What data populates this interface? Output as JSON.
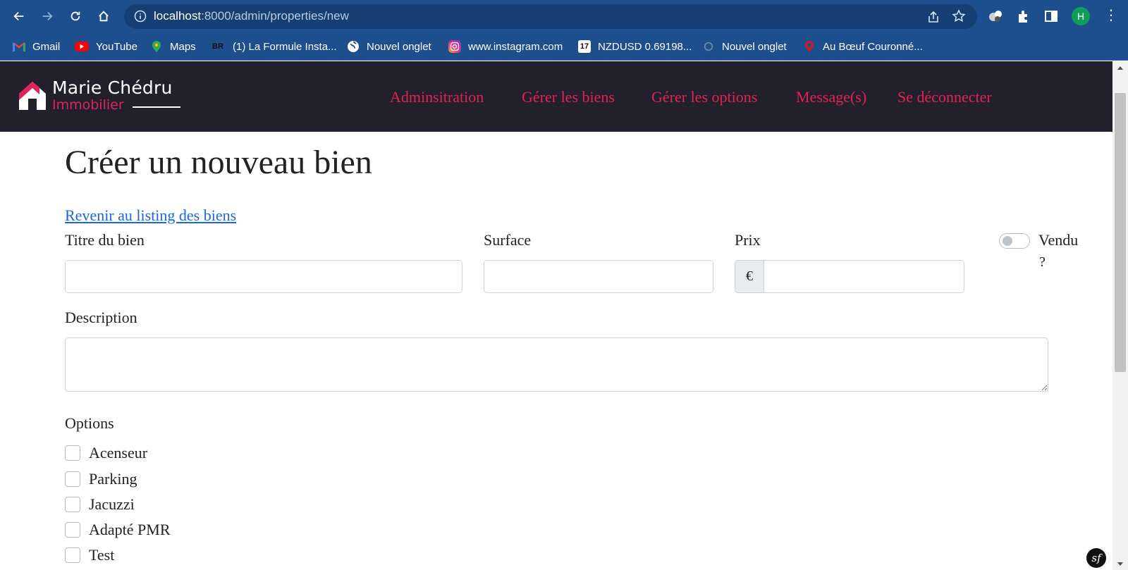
{
  "browser": {
    "url_host": "localhost",
    "url_path": ":8000/admin/properties/new",
    "profile_initial": "H",
    "bookmarks": [
      {
        "label": "Gmail",
        "icon": "gmail-icon"
      },
      {
        "label": "YouTube",
        "icon": "youtube-icon"
      },
      {
        "label": "Maps",
        "icon": "maps-icon"
      },
      {
        "label": "(1) La Formule Insta...",
        "icon": "br-icon",
        "icon_text": "BR"
      },
      {
        "label": "Nouvel onglet",
        "icon": "globe-icon"
      },
      {
        "label": "www.instagram.com",
        "icon": "instagram-icon"
      },
      {
        "label": "NZDUSD 0.69198...",
        "icon": "tradingview-icon",
        "icon_text": "17"
      },
      {
        "label": "Nouvel onglet",
        "icon": "page-icon"
      },
      {
        "label": "Au Bœuf Couronné...",
        "icon": "restaurant-icon"
      }
    ]
  },
  "site": {
    "logo_name": "Marie Chédru",
    "logo_sub": "Immobilier",
    "menu": [
      "Adminsitration",
      "Gérer les biens",
      "Gérer les options",
      "Message(s)",
      "Se déconnecter"
    ],
    "accent": "#e0244d",
    "header_bg": "#22202d"
  },
  "page": {
    "title": "Créer un nouveau bien",
    "back_link": "Revenir au listing des biens"
  },
  "form": {
    "title_label": "Titre du bien",
    "title_value": "",
    "surface_label": "Surface",
    "surface_value": "",
    "price_label": "Prix",
    "price_value": "",
    "currency": "€",
    "sold_label": "Vendu",
    "sold_label_q": "?",
    "sold_checked": false,
    "description_label": "Description",
    "description_value": "",
    "options_label": "Options",
    "options": [
      "Acenseur",
      "Parking",
      "Jacuzzi",
      "Adapté PMR",
      "Test"
    ]
  },
  "debug": {
    "badge": "sf"
  }
}
